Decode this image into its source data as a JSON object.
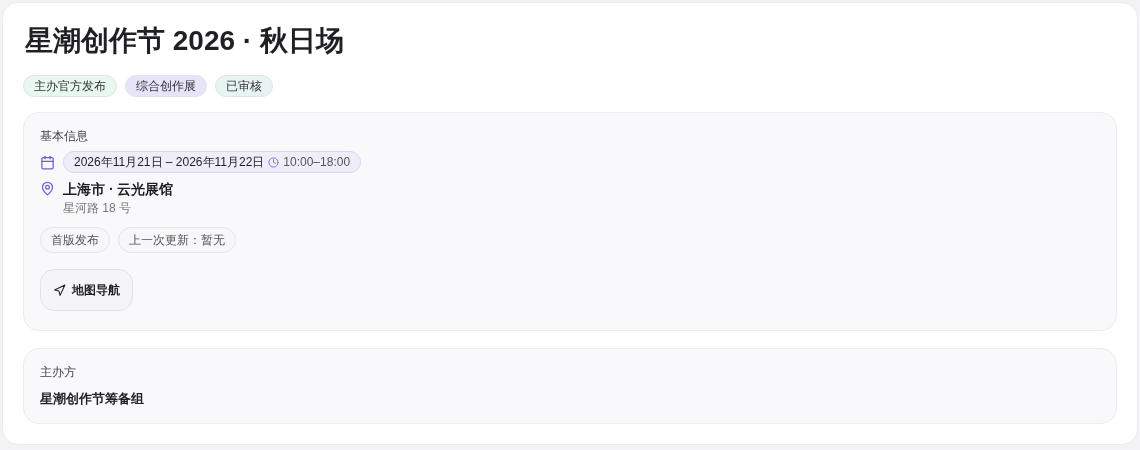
{
  "title": "星潮创作节 2026 · 秋日场",
  "tags": [
    {
      "label": "主办官方发布",
      "color": "#e8f7ef"
    },
    {
      "label": "综合创作展",
      "color": "#e6e3fa"
    },
    {
      "label": "已审核",
      "color": "#e8f4f4"
    }
  ],
  "basic_info": {
    "heading": "基本信息",
    "date_range": "2026年11月21日 – 2026年11月22日",
    "time": "10:00–18:00",
    "venue": "上海市 · 云光展馆",
    "address": "星河路 18 号",
    "chips": [
      "首版发布",
      "上一次更新：暂无"
    ],
    "nav_button": "地图导航"
  },
  "organizer": {
    "heading": "主办方",
    "name": "星潮创作节筹备组"
  }
}
